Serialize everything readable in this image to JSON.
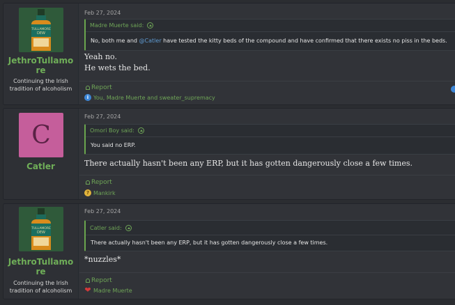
{
  "posts": [
    {
      "username": "JethroTullamore",
      "user_title": "Continuing the Irish tradition of alcoholism",
      "avatar": "whiskey-bottle",
      "date": "Feb 27, 2024",
      "quote_author": "Madre Muerte said:",
      "quote_pre": "No, both me and ",
      "quote_mention": "@Catler",
      "quote_post": " have tested the kitty beds of the compound and have confirmed that there exists no piss in the beds.",
      "message_lines": [
        "Yeah no.",
        "He wets the bed."
      ],
      "report_label": "Report",
      "reactions": "You, Madre Muerte and sweater_supremacy",
      "reaction_icon": "info"
    },
    {
      "username": "Catler",
      "user_title": "",
      "avatar_letter": "C",
      "date": "Feb 27, 2024",
      "quote_author": "Omori Boy said:",
      "quote_text": "You said no ERP.",
      "message_lines": [
        "There actually hasn't been any ERP, but it has gotten dangerously close a few times."
      ],
      "report_label": "Report",
      "reactions": "Mankirk",
      "reaction_icon": "thinking"
    },
    {
      "username": "JethroTullamore",
      "user_title": "Continuing the Irish tradition of alcoholism",
      "avatar": "whiskey-bottle",
      "date": "Feb 27, 2024",
      "quote_author": "Catler said:",
      "quote_text": "There actually hasn't been any ERP, but it has gotten dangerously close a few times.",
      "message_lines": [
        "*nuzzles*"
      ],
      "report_label": "Report",
      "reactions": "Madre Muerte",
      "reaction_icon": "heart"
    }
  ],
  "colors": {
    "background": "#2b2d31",
    "post_bg": "#313338",
    "accent_green": "#6fae58",
    "catler_avatar": "#c55e9b"
  }
}
